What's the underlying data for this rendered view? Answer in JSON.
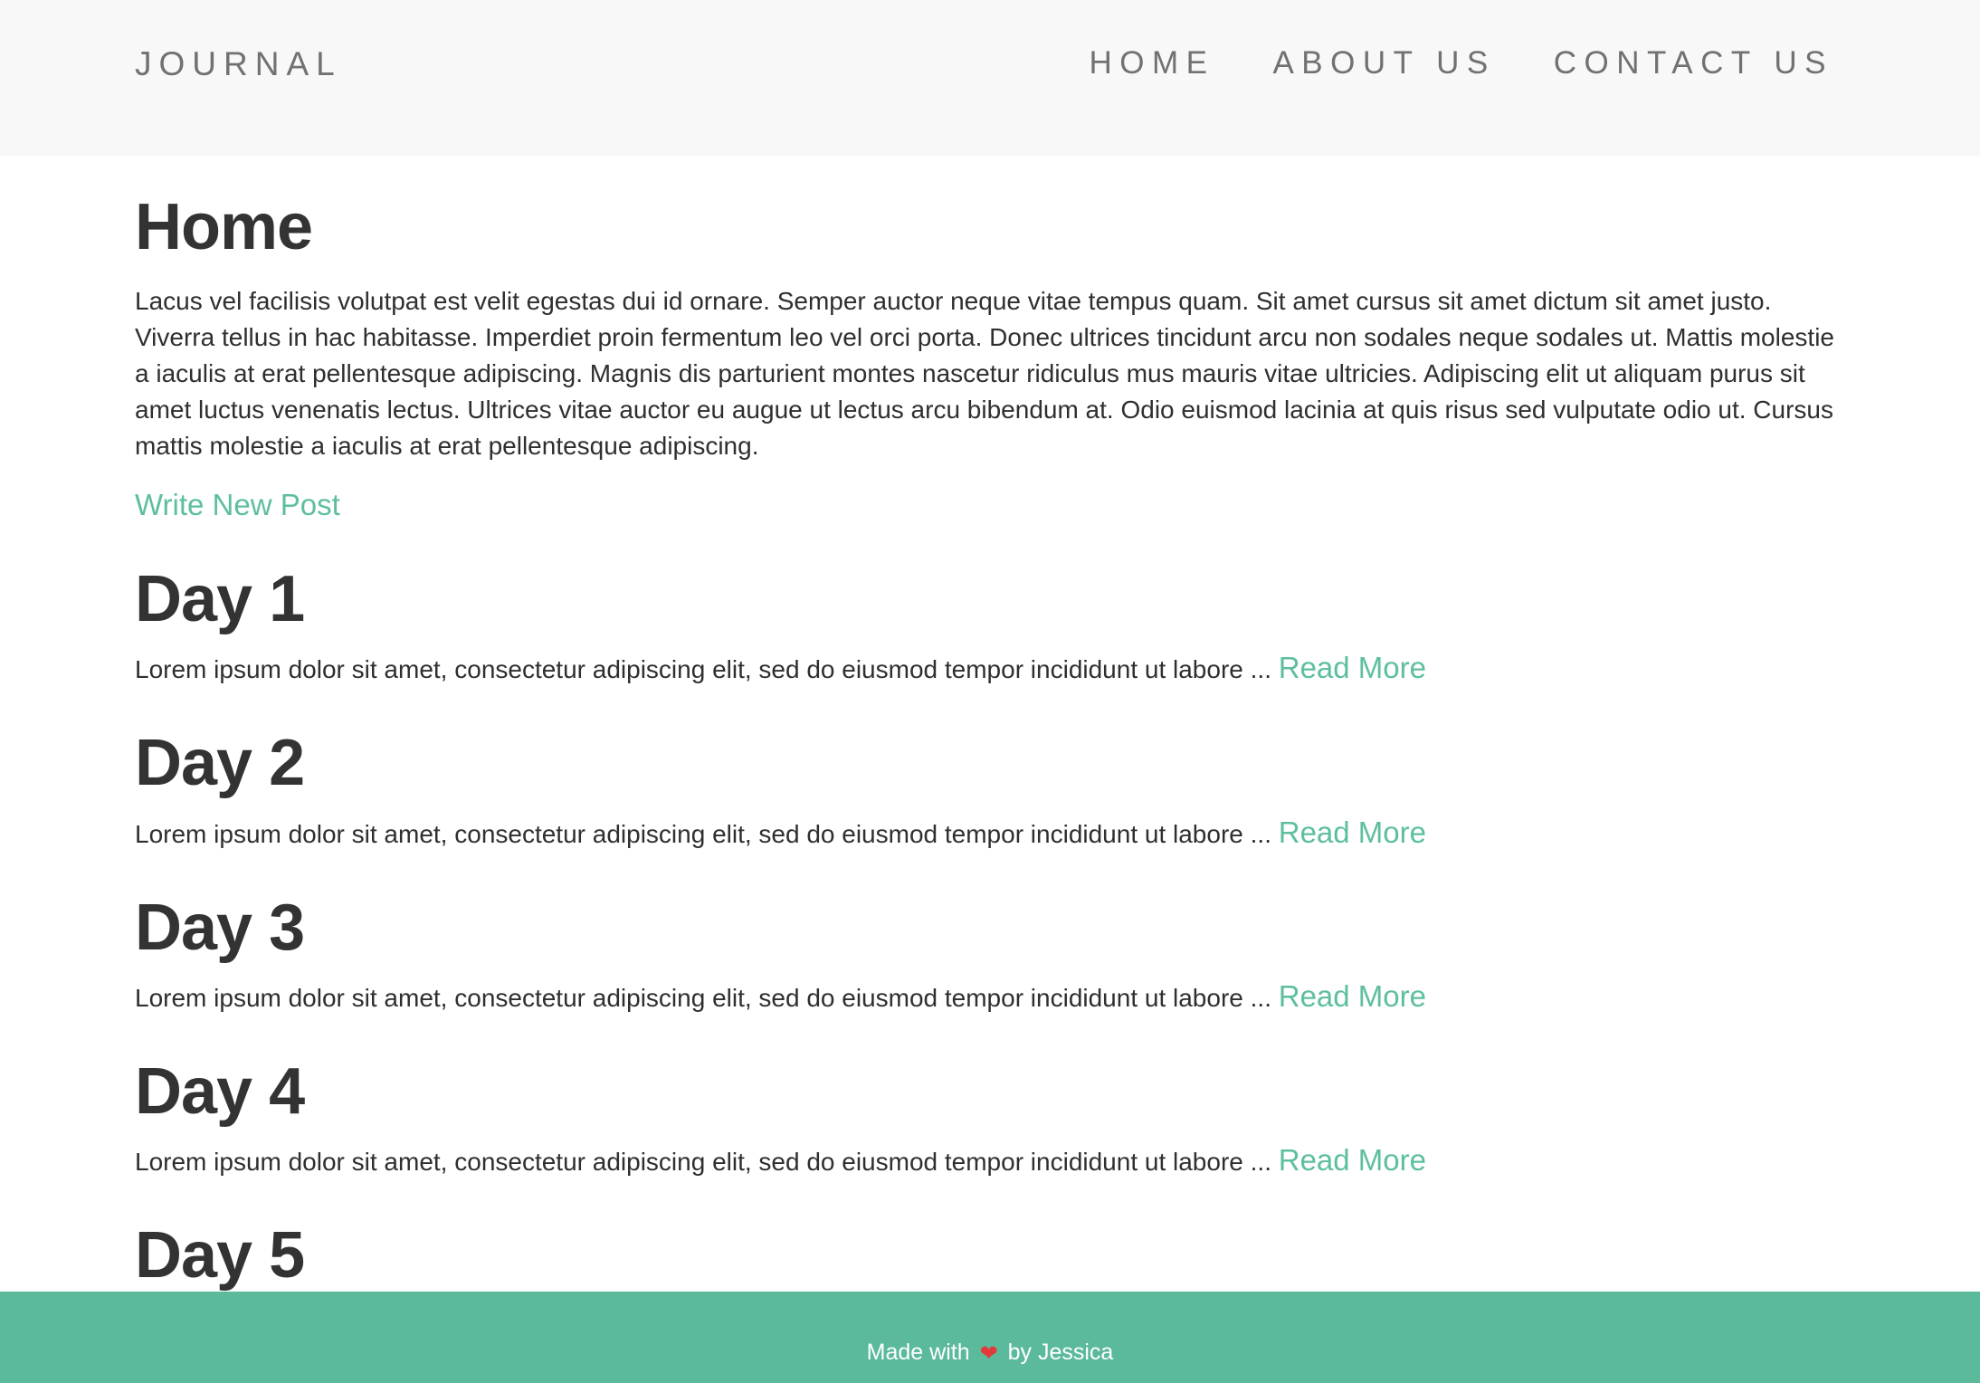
{
  "header": {
    "brand": "JOURNAL",
    "nav": [
      "HOME",
      "ABOUT US",
      "CONTACT US"
    ]
  },
  "main": {
    "title": "Home",
    "intro": "Lacus vel facilisis volutpat est velit egestas dui id ornare. Semper auctor neque vitae tempus quam. Sit amet cursus sit amet dictum sit amet justo. Viverra tellus in hac habitasse. Imperdiet proin fermentum leo vel orci porta. Donec ultrices tincidunt arcu non sodales neque sodales ut. Mattis molestie a iaculis at erat pellentesque adipiscing. Magnis dis parturient montes nascetur ridiculus mus mauris vitae ultricies. Adipiscing elit ut aliquam purus sit amet luctus venenatis lectus. Ultrices vitae auctor eu augue ut lectus arcu bibendum at. Odio euismod lacinia at quis risus sed vulputate odio ut. Cursus mattis molestie a iaculis at erat pellentesque adipiscing.",
    "write_link": "Write New Post",
    "posts": [
      {
        "title": "Day 1",
        "excerpt": "Lorem ipsum dolor sit amet, consectetur adipiscing elit, sed do eiusmod tempor incididunt ut labore ...",
        "read_more": "Read More"
      },
      {
        "title": "Day 2",
        "excerpt": "Lorem ipsum dolor sit amet, consectetur adipiscing elit, sed do eiusmod tempor incididunt ut labore ...",
        "read_more": "Read More"
      },
      {
        "title": "Day 3",
        "excerpt": "Lorem ipsum dolor sit amet, consectetur adipiscing elit, sed do eiusmod tempor incididunt ut labore ...",
        "read_more": "Read More"
      },
      {
        "title": "Day 4",
        "excerpt": "Lorem ipsum dolor sit amet, consectetur adipiscing elit, sed do eiusmod tempor incididunt ut labore ...",
        "read_more": "Read More"
      },
      {
        "title": "Day 5"
      }
    ]
  },
  "footer": {
    "text_before": "Made with",
    "icon": "heart-icon",
    "text_after": "by Jessica"
  },
  "colors": {
    "accent": "#5dbf9d",
    "footer_bg": "#5bb99c",
    "header_bg": "#f8f8f8",
    "heading": "#333333",
    "nav_text": "#717171"
  }
}
